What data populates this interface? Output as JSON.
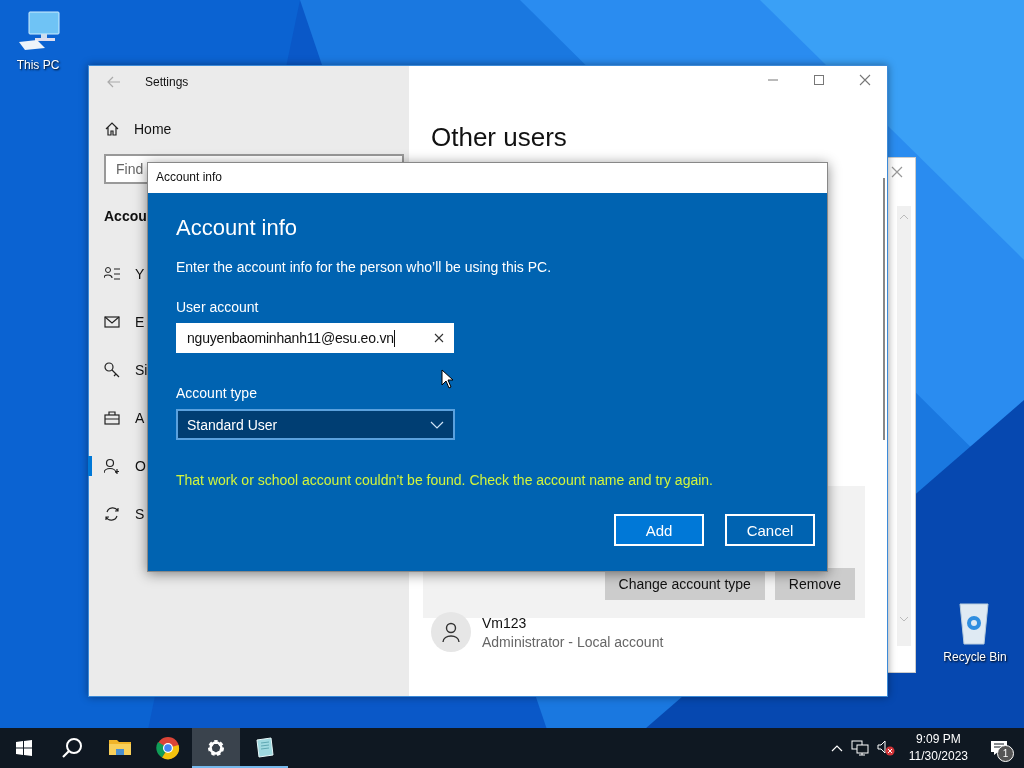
{
  "desktop_icons": [
    {
      "label": "This PC"
    },
    {
      "label": "Recycle Bin"
    }
  ],
  "settings_window": {
    "title": "Settings",
    "home": "Home",
    "search": {
      "placeholder": "Find"
    },
    "section_heading": "Accou",
    "items": [
      {
        "label": "Y",
        "selected": false
      },
      {
        "label": "E",
        "selected": false
      },
      {
        "label": "Si",
        "selected": false
      },
      {
        "label": "A",
        "selected": false
      },
      {
        "label": "O",
        "selected": true
      },
      {
        "label": "S",
        "selected": false
      }
    ],
    "heading": "Other users",
    "card_buttons": [
      "Change account type",
      "Remove"
    ],
    "user": {
      "name": "Vm123",
      "detail": "Administrator - Local account"
    }
  },
  "dialog": {
    "title": "Account info",
    "heading": "Account info",
    "description": "Enter the account info for the person who’ll be using this PC.",
    "user_account": {
      "label": "User account",
      "value": "nguyenbaominhanh11@esu.eo.vn"
    },
    "account_type": {
      "label": "Account type",
      "value": "Standard User"
    },
    "error": "That work or school account couldn’t be found. Check the account name and try again.",
    "buttons": [
      {
        "label": "Add",
        "default": true
      },
      {
        "label": "Cancel",
        "default": false
      }
    ]
  },
  "taskbar": {
    "apps": [
      {
        "selected": false,
        "running": false
      },
      {
        "selected": false,
        "running": false
      },
      {
        "selected": true,
        "running": true
      },
      {
        "selected": false,
        "running": true
      }
    ],
    "time": "9:09 PM",
    "date": "11/30/2023",
    "notification_count": "1"
  }
}
